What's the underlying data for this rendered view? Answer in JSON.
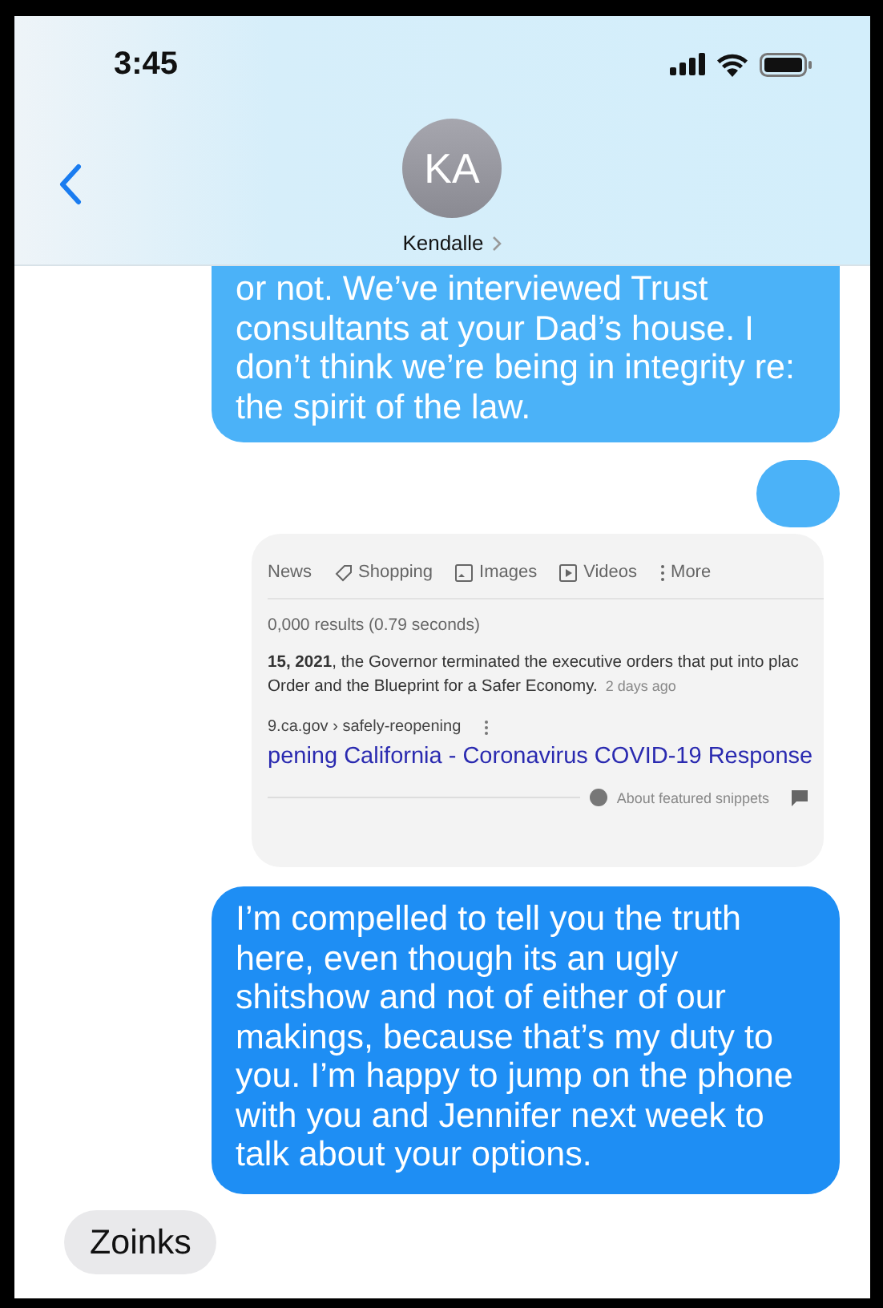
{
  "status_bar": {
    "time": "3:45"
  },
  "header": {
    "avatar_initials": "KA",
    "contact_name": "Kendalle"
  },
  "messages": [
    {
      "kind": "sent",
      "text": "or not. We’ve interviewed Trust consultants at your Dad’s house. I don’t think we’re being in integrity re: the spirit of the law."
    },
    {
      "kind": "sent_blank"
    },
    {
      "kind": "screenshot",
      "tabs": [
        "News",
        "Shopping",
        "Images",
        "Videos",
        "More"
      ],
      "result_stats": "0,000 results (0.79 seconds)",
      "snippet": [
        "**15, 2021**, the Governor terminated the executive orders that put into plac",
        "Order and the Blueprint for a Safer Economy."
      ],
      "age": "2 days ago",
      "breadcrumb": "9.ca.gov › safely-reopening",
      "link_title": "pening California - Coronavirus COVID-19 Response",
      "footer": "About featured snippets"
    },
    {
      "kind": "sent",
      "text": "I’m compelled to tell you the truth here, even though its an ugly shitshow and not of either of our makings, because that’s my duty to you. I’m happy to jump on the phone with you and Jennifer next week to talk about your options."
    },
    {
      "kind": "received",
      "text": "Zoinks"
    }
  ]
}
